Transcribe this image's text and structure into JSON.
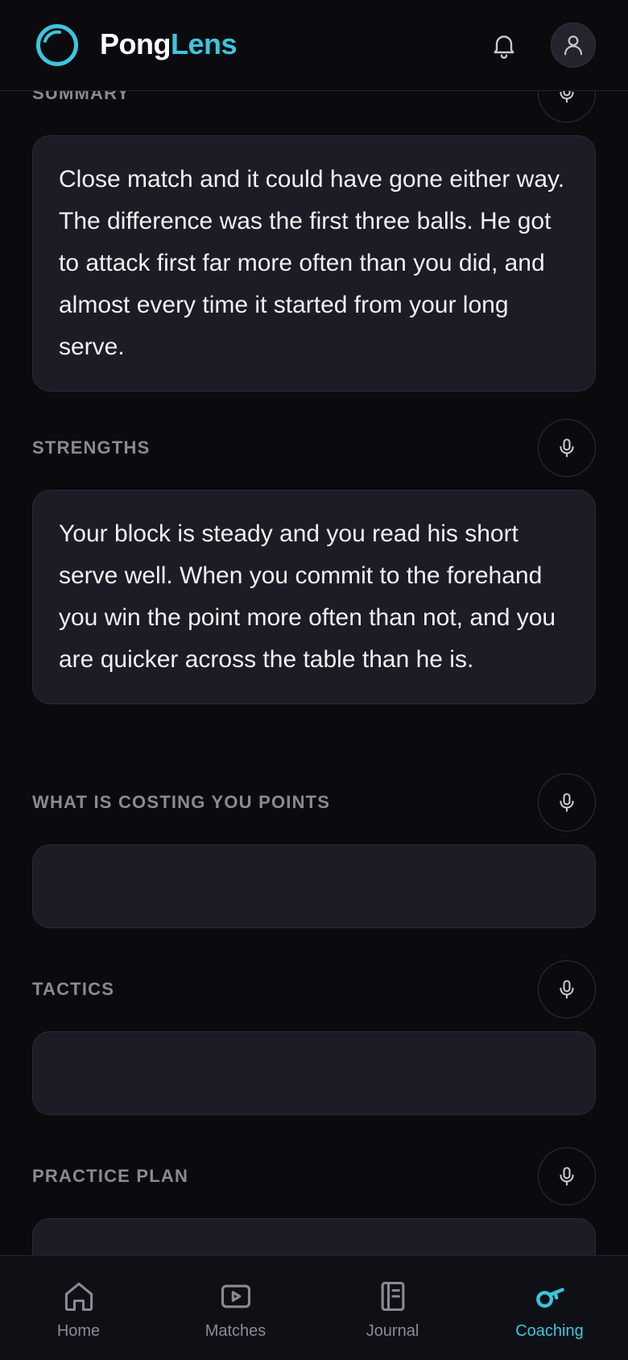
{
  "header": {
    "brand_part1": "Pong",
    "brand_part2": "Lens"
  },
  "sections": [
    {
      "title": "SUMMARY",
      "text": "Close match and it could have gone either way. The difference was the first three balls. He got to attack first far more often than you did, and almost every time it started from your long serve."
    },
    {
      "title": "STRENGTHS",
      "text": "Your block is steady and you read his short serve well. When you commit to the forehand you win the point more often than not, and you are quicker across the table than he is."
    },
    {
      "title": "WHAT IS COSTING YOU POINTS",
      "text": ""
    },
    {
      "title": "TACTICS",
      "text": ""
    },
    {
      "title": "PRACTICE PLAN",
      "text": ""
    }
  ],
  "nav": {
    "items": [
      {
        "label": "Home",
        "icon": "home-icon"
      },
      {
        "label": "Matches",
        "icon": "play-icon"
      },
      {
        "label": "Journal",
        "icon": "journal-icon"
      },
      {
        "label": "Coaching",
        "icon": "whistle-icon",
        "active": true
      }
    ]
  },
  "colors": {
    "accent": "#3cc6dd",
    "background": "#0b0b0f",
    "card": "#1b1c25",
    "muted": "#8a8a94"
  }
}
